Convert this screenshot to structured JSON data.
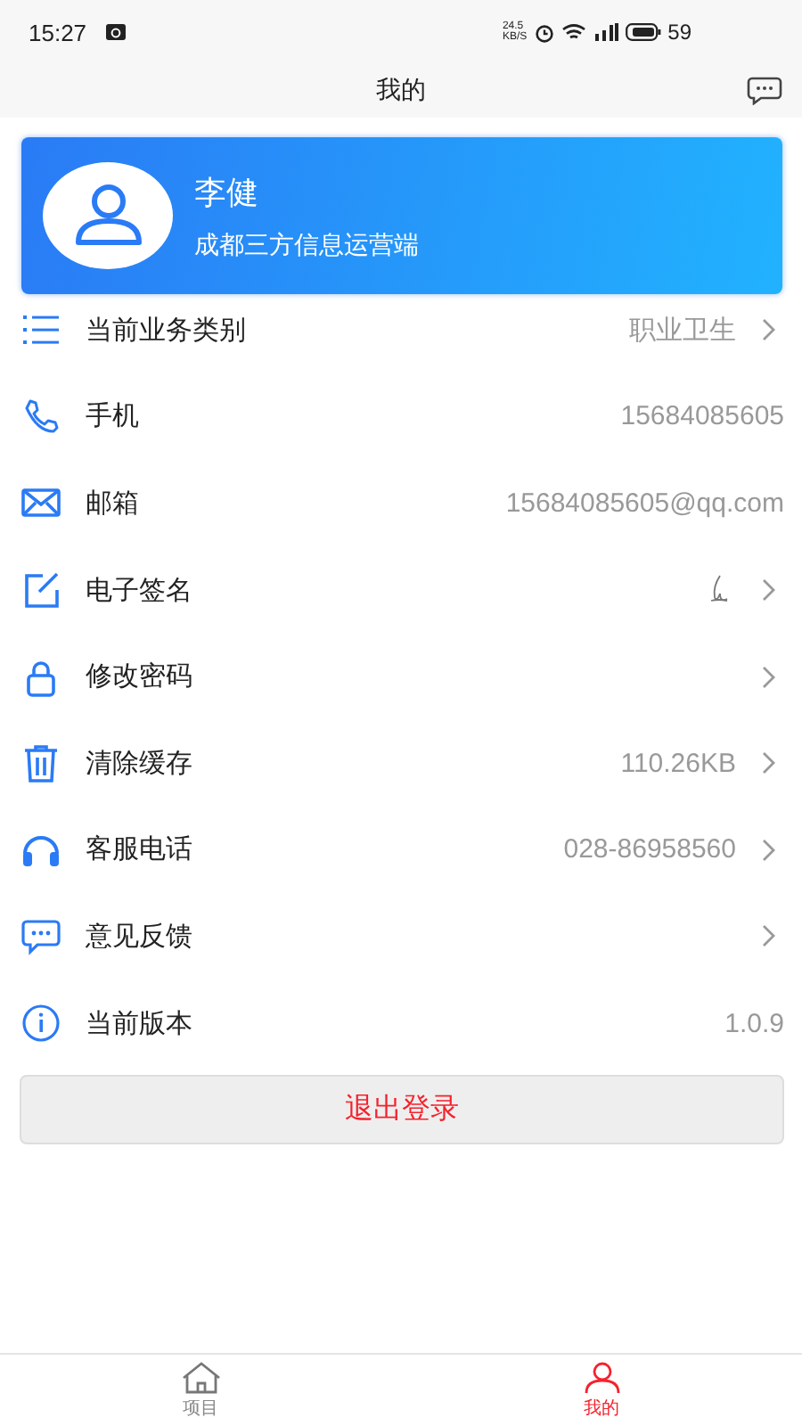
{
  "status_bar": {
    "time": "15:27",
    "speed": "24.5",
    "speed_unit": "KB/S",
    "battery": "59"
  },
  "header": {
    "title": "我的"
  },
  "profile": {
    "name": "李健",
    "organization": "成都三方信息运营端"
  },
  "rows": [
    {
      "label": "当前业务类别",
      "value": "职业卫生",
      "chevron": true,
      "signature": false
    },
    {
      "label": "手机",
      "value": "15684085605",
      "chevron": false,
      "signature": false
    },
    {
      "label": "邮箱",
      "value": "15684085605@qq.com",
      "chevron": false,
      "signature": false
    },
    {
      "label": "电子签名",
      "chevron": true,
      "signature": true
    },
    {
      "label": "修改密码",
      "chevron": true,
      "signature": false
    },
    {
      "label": "清除缓存",
      "value": "110.26KB",
      "chevron": true,
      "signature": false
    },
    {
      "label": "客服电话",
      "value": "028-86958560",
      "chevron": true,
      "signature": false
    },
    {
      "label": "意见反馈",
      "chevron": true,
      "signature": false
    },
    {
      "label": "当前版本",
      "value": "1.0.9",
      "chevron": false,
      "signature": false
    }
  ],
  "logout_button": "退出登录",
  "tabs": [
    {
      "label": "项目",
      "selected": false
    },
    {
      "label": "我的",
      "selected": true
    }
  ]
}
